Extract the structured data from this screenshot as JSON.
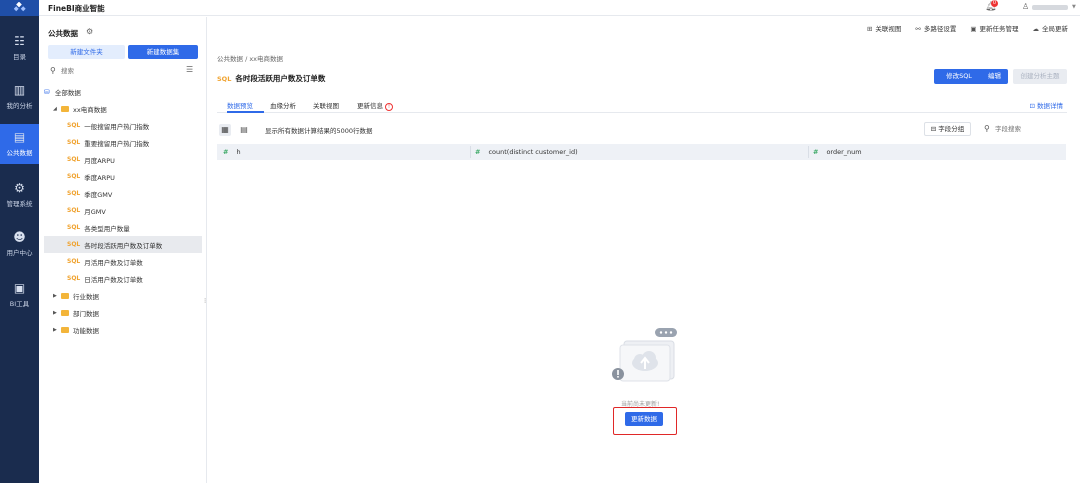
{
  "app": {
    "title": "FineBI商业智能"
  },
  "nav": {
    "items": [
      {
        "label": "目录",
        "icon": "catalog-icon",
        "glyph": "☷"
      },
      {
        "label": "我的分析",
        "icon": "analysis-icon",
        "glyph": "▥"
      },
      {
        "label": "公共数据",
        "icon": "public-data-icon",
        "glyph": "▤",
        "active": true
      },
      {
        "label": "管理系统",
        "icon": "settings-icon",
        "glyph": "⚙"
      },
      {
        "label": "用户中心",
        "icon": "user-icon",
        "glyph": "☻"
      },
      {
        "label": "BI工具",
        "icon": "toolbox-icon",
        "glyph": "▣"
      }
    ]
  },
  "header": {
    "notification_count": "0"
  },
  "panel": {
    "title": "公共数据",
    "new_folder": "新建文件夹",
    "new_dataset": "新建数据集",
    "search_placeholder": "搜索",
    "tree": {
      "root": "全部数据",
      "folder_open": "xx电商数据",
      "datasets": [
        "一般搜留用户热门指数",
        "重要搜留用户热门指数",
        "月度ARPU",
        "季度ARPU",
        "季度GMV",
        "月GMV",
        "各类型用户数量",
        "各时段活跃用户数及订单数",
        "月活用户数及订单数",
        "日活用户数及订单数"
      ],
      "folders": [
        "行业数据",
        "部门数据",
        "功能数据"
      ]
    }
  },
  "toolbar": {
    "related_view": "关联视图",
    "multi_path": "多路径设置",
    "update_task": "更新任务管理",
    "global_update": "全局更新"
  },
  "main": {
    "breadcrumb": "公共数据  /  xx电商数据",
    "title": "各时段活跃用户数及订单数",
    "edit_sql": "修改SQL",
    "edit": "编辑",
    "create_topic": "创建分析主题",
    "tabs": [
      "数据预览",
      "血缘分析",
      "关联视图",
      "更新信息"
    ],
    "detail_link": "数据详情",
    "rows_note": "显示所有数据计算结果的5000行数据",
    "field_group": "字段分组",
    "field_search_placeholder": "字段搜索",
    "columns": [
      "h",
      "count(distinct customer_id)",
      "order_num"
    ],
    "empty_text": "当前尚未更新!",
    "update_button": "更新数据"
  },
  "colors": {
    "accent": "#2f6ae8",
    "nav_bg": "#1a2c4e",
    "highlight": "#e02828"
  }
}
